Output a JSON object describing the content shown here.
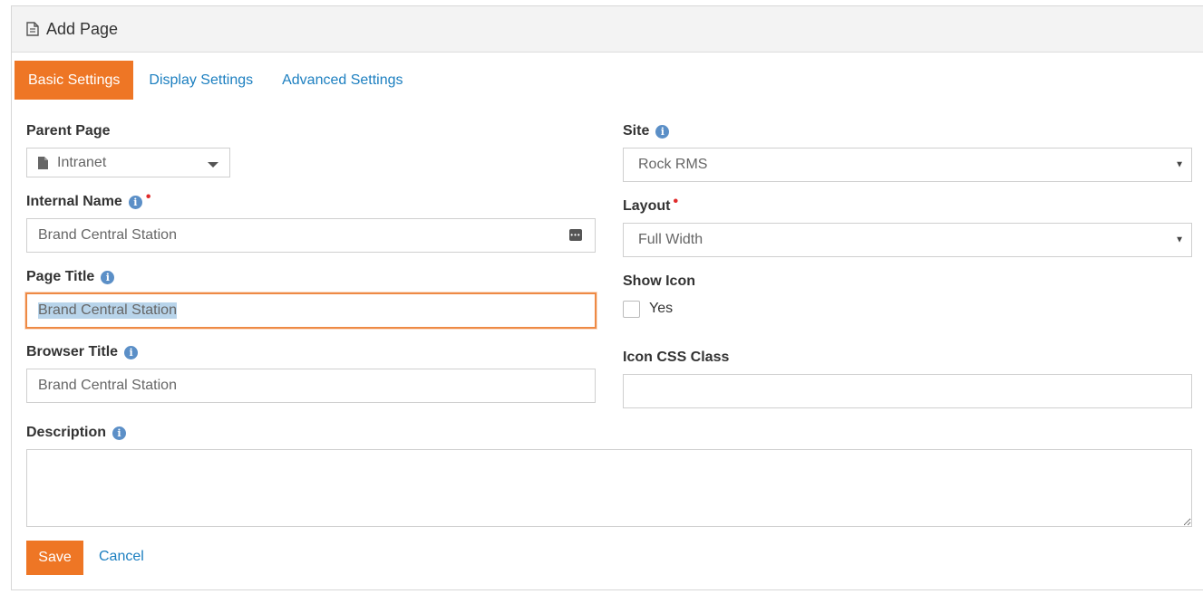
{
  "panel": {
    "title": "Add Page",
    "title_icon": "file-icon"
  },
  "tabs": [
    {
      "label": "Basic Settings",
      "active": true
    },
    {
      "label": "Display Settings",
      "active": false
    },
    {
      "label": "Advanced Settings",
      "active": false
    }
  ],
  "fields": {
    "parent_page": {
      "label": "Parent Page",
      "value": "Intranet"
    },
    "internal_name": {
      "label": "Internal Name",
      "value": "Brand Central Station",
      "required": true
    },
    "page_title": {
      "label": "Page Title",
      "value": "Brand Central Station"
    },
    "browser_title": {
      "label": "Browser Title",
      "value": "Brand Central Station"
    },
    "description": {
      "label": "Description",
      "value": ""
    },
    "site": {
      "label": "Site",
      "value": "Rock RMS"
    },
    "layout": {
      "label": "Layout",
      "value": "Full Width",
      "required": true
    },
    "show_icon": {
      "label": "Show Icon",
      "option": "Yes",
      "checked": false
    },
    "icon_css_class": {
      "label": "Icon CSS Class",
      "value": ""
    }
  },
  "buttons": {
    "save": "Save",
    "cancel": "Cancel"
  },
  "colors": {
    "accent": "#ee7625",
    "link": "#1c7fc0",
    "info": "#5b8fc7",
    "required": "#e02b2b"
  }
}
